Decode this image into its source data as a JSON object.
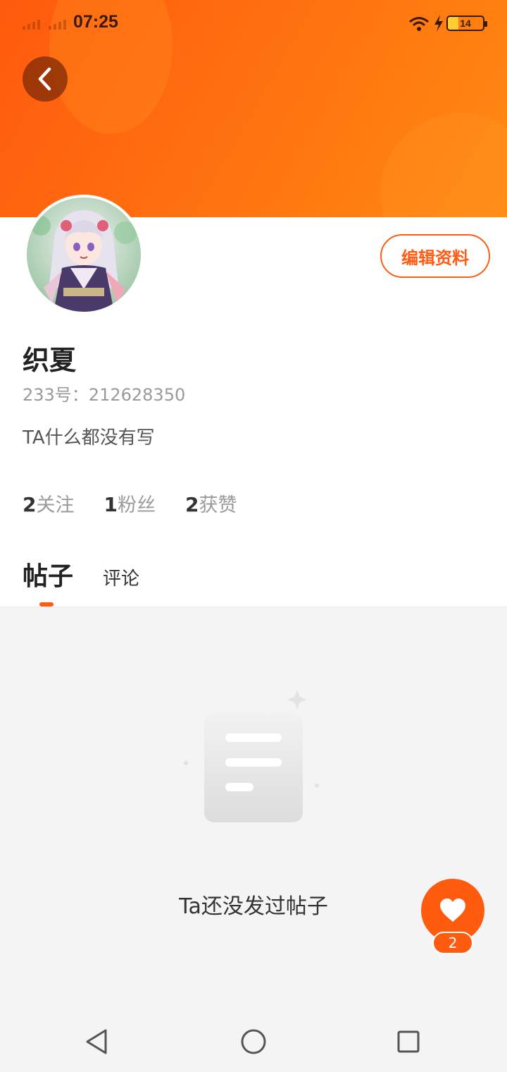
{
  "status_bar": {
    "time": "07:25",
    "battery": "14"
  },
  "profile": {
    "name": "织夏",
    "uid": "233号：212628350",
    "bio": "TA什么都没有写",
    "edit_label": "编辑资料"
  },
  "stats": [
    {
      "num": "2",
      "label": "关注"
    },
    {
      "num": "1",
      "label": "粉丝"
    },
    {
      "num": "2",
      "label": "获赞"
    }
  ],
  "tabs": [
    {
      "label": "帖子",
      "active": true
    },
    {
      "label": "评论",
      "active": false
    }
  ],
  "empty_state": {
    "text": "Ta还没发过帖子"
  },
  "like": {
    "count": "2"
  },
  "colors": {
    "accent": "#ff5b12",
    "banner": "#ff6f10"
  },
  "icons": [
    "back-arrow-icon",
    "wifi-icon",
    "charging-icon",
    "battery-icon",
    "heart-icon",
    "document-icon",
    "nav-back-icon",
    "nav-home-icon",
    "nav-recents-icon"
  ]
}
